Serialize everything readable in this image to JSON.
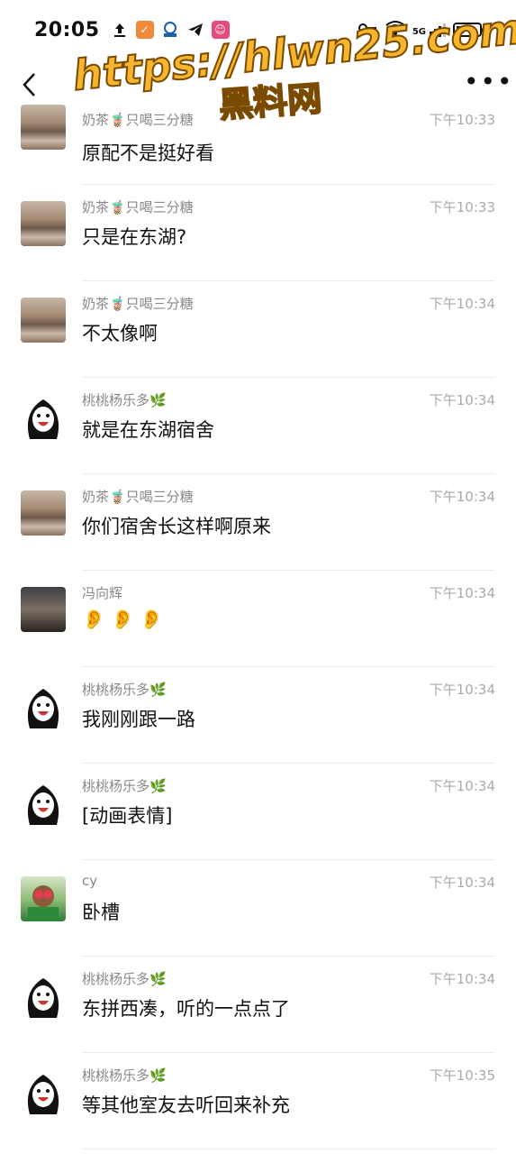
{
  "status_bar": {
    "time": "20:05",
    "left_icons": [
      "upload-icon",
      "shield-app-icon",
      "badge-app-icon",
      "telegram-icon",
      "app-icon"
    ],
    "right_icons": [
      "key-icon",
      "wifi-icon",
      "5g-signal-icon",
      "battery-icon"
    ],
    "network_label": "5G"
  },
  "nav": {
    "back": "back-icon",
    "more": "•••"
  },
  "watermark": {
    "url": "https://hlwn25.com",
    "cn": "黑料网"
  },
  "messages": [
    {
      "sender": "奶茶🧋只喝三分糖",
      "time": "下午10:33",
      "text": "原配不是挺好看",
      "avatar": "landscape"
    },
    {
      "sender": "奶茶🧋只喝三分糖",
      "time": "下午10:33",
      "text": "只是在东湖?",
      "avatar": "landscape"
    },
    {
      "sender": "奶茶🧋只喝三分糖",
      "time": "下午10:34",
      "text": "不太像啊",
      "avatar": "landscape"
    },
    {
      "sender": "桃桃杨乐多🌿",
      "time": "下午10:34",
      "text": "就是在东湖宿舍",
      "avatar": "girl"
    },
    {
      "sender": "奶茶🧋只喝三分糖",
      "time": "下午10:34",
      "text": "你们宿舍长这样啊原来",
      "avatar": "landscape"
    },
    {
      "sender": "冯向辉",
      "time": "下午10:34",
      "text": "👂👂👂",
      "avatar": "beach"
    },
    {
      "sender": "桃桃杨乐多🌿",
      "time": "下午10:34",
      "text": "我刚刚跟一路",
      "avatar": "girl"
    },
    {
      "sender": "桃桃杨乐多🌿",
      "time": "下午10:34",
      "text": "[动画表情]",
      "avatar": "girl"
    },
    {
      "sender": "cy",
      "time": "下午10:34",
      "text": "卧槽",
      "avatar": "cy"
    },
    {
      "sender": "桃桃杨乐多🌿",
      "time": "下午10:34",
      "text": "东拼西凑，听的一点点了",
      "avatar": "girl"
    },
    {
      "sender": "桃桃杨乐多🌿",
      "time": "下午10:35",
      "text": "等其他室友去听回来补充",
      "avatar": "girl"
    }
  ]
}
